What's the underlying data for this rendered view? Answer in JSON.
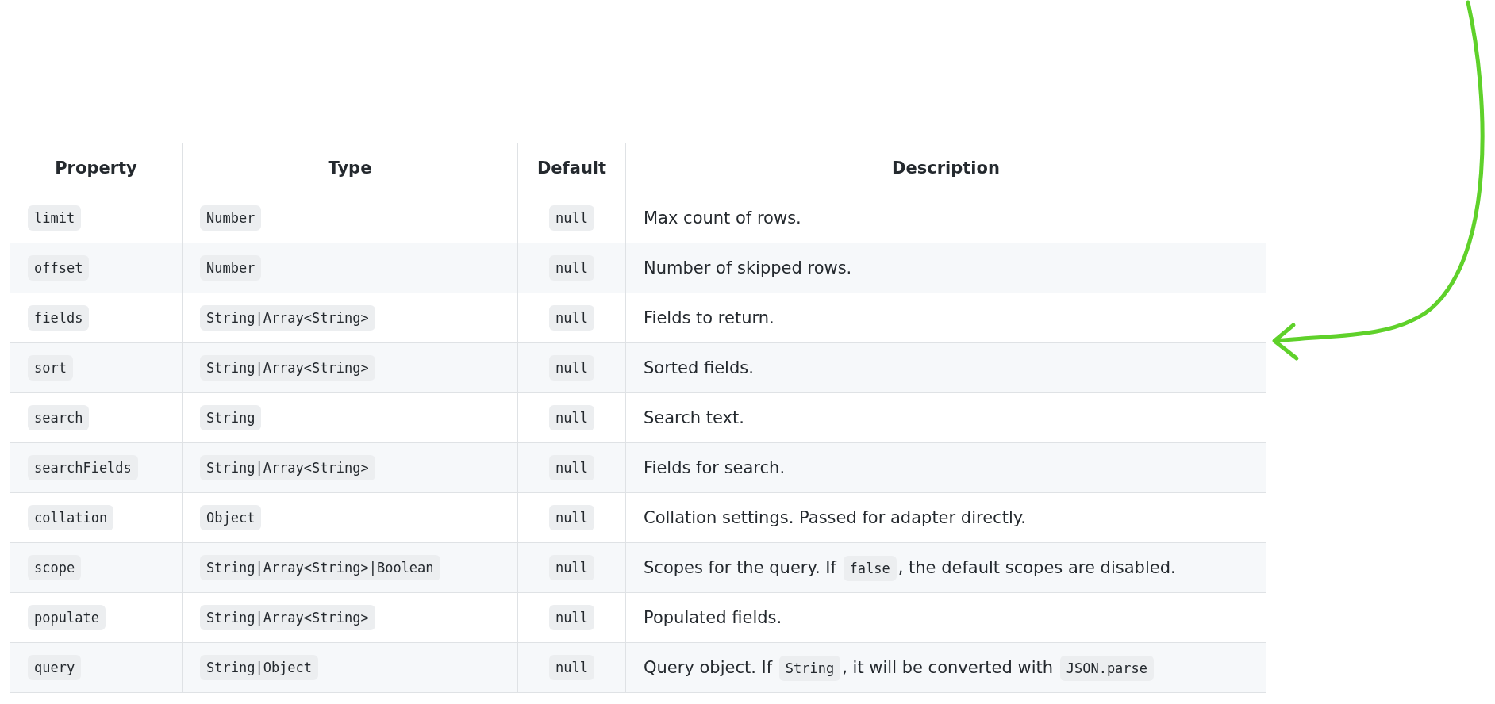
{
  "table": {
    "columns": [
      "Property",
      "Type",
      "Default",
      "Description"
    ],
    "rows": [
      {
        "property": "limit",
        "type": "Number",
        "default": "null",
        "description": [
          {
            "kind": "text",
            "text": "Max count of rows."
          }
        ]
      },
      {
        "property": "offset",
        "type": "Number",
        "default": "null",
        "description": [
          {
            "kind": "text",
            "text": "Number of skipped rows."
          }
        ]
      },
      {
        "property": "fields",
        "type": "String|Array<String>",
        "default": "null",
        "description": [
          {
            "kind": "text",
            "text": "Fields to return."
          }
        ]
      },
      {
        "property": "sort",
        "type": "String|Array<String>",
        "default": "null",
        "description": [
          {
            "kind": "text",
            "text": "Sorted fields."
          }
        ]
      },
      {
        "property": "search",
        "type": "String",
        "default": "null",
        "description": [
          {
            "kind": "text",
            "text": "Search text."
          }
        ]
      },
      {
        "property": "searchFields",
        "type": "String|Array<String>",
        "default": "null",
        "description": [
          {
            "kind": "text",
            "text": "Fields for search."
          }
        ]
      },
      {
        "property": "collation",
        "type": "Object",
        "default": "null",
        "description": [
          {
            "kind": "text",
            "text": "Collation settings. Passed for adapter directly."
          }
        ]
      },
      {
        "property": "scope",
        "type": "String|Array<String>|Boolean",
        "default": "null",
        "description": [
          {
            "kind": "text",
            "text": "Scopes for the query. If "
          },
          {
            "kind": "code",
            "text": "false"
          },
          {
            "kind": "text",
            "text": ", the default scopes are disabled."
          }
        ]
      },
      {
        "property": "populate",
        "type": "String|Array<String>",
        "default": "null",
        "description": [
          {
            "kind": "text",
            "text": "Populated fields."
          }
        ]
      },
      {
        "property": "query",
        "type": "String|Object",
        "default": "null",
        "description": [
          {
            "kind": "text",
            "text": "Query object. If "
          },
          {
            "kind": "code",
            "text": "String"
          },
          {
            "kind": "text",
            "text": ", it will be converted with "
          },
          {
            "kind": "code",
            "text": "JSON.parse"
          }
        ]
      }
    ]
  }
}
